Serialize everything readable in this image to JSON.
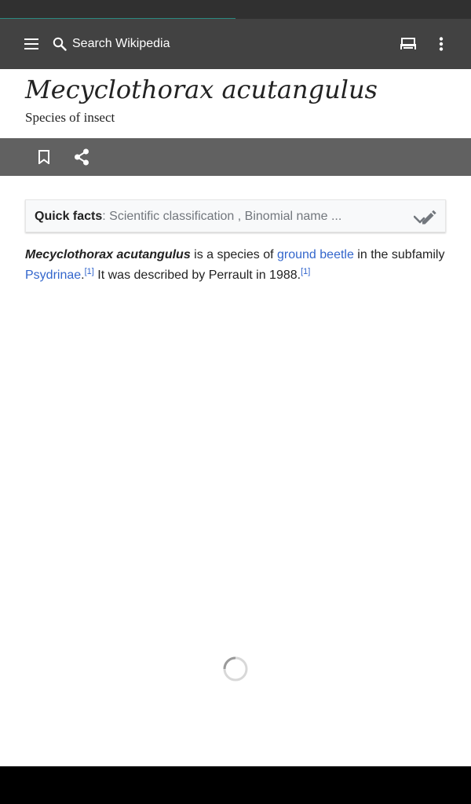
{
  "app": {
    "search_placeholder": "Search Wikipedia",
    "page_load_progress": 0.5
  },
  "article": {
    "title": "Mecyclothorax acutangulus",
    "description": "Species of insect"
  },
  "quick_facts": {
    "label": "Quick facts",
    "separator": ": ",
    "summary": "Scientific classification , Binomial name ..."
  },
  "body": {
    "subject": "Mecyclothorax acutangulus",
    "text_1": " is a species of ",
    "link_1": "ground beetle",
    "text_2": " in the subfamily ",
    "link_2": "Psydrinae",
    "text_3": ".",
    "ref_1": "[1]",
    "text_4": " It was described by Perrault in 1988.",
    "ref_2": "[1]"
  },
  "icons": {
    "menu": "menu-icon",
    "search": "search-icon",
    "tabs": "tabs-icon",
    "overflow": "more-vert-icon",
    "bookmark": "bookmark-icon",
    "share": "share-icon",
    "edit": "edit-check-icon",
    "loading": "loading-spinner-icon"
  },
  "colors": {
    "status_bar": "#303030",
    "progress": "#2c8a80",
    "app_bar": "#424242",
    "action_bar": "#616161",
    "link": "#3366cc"
  }
}
